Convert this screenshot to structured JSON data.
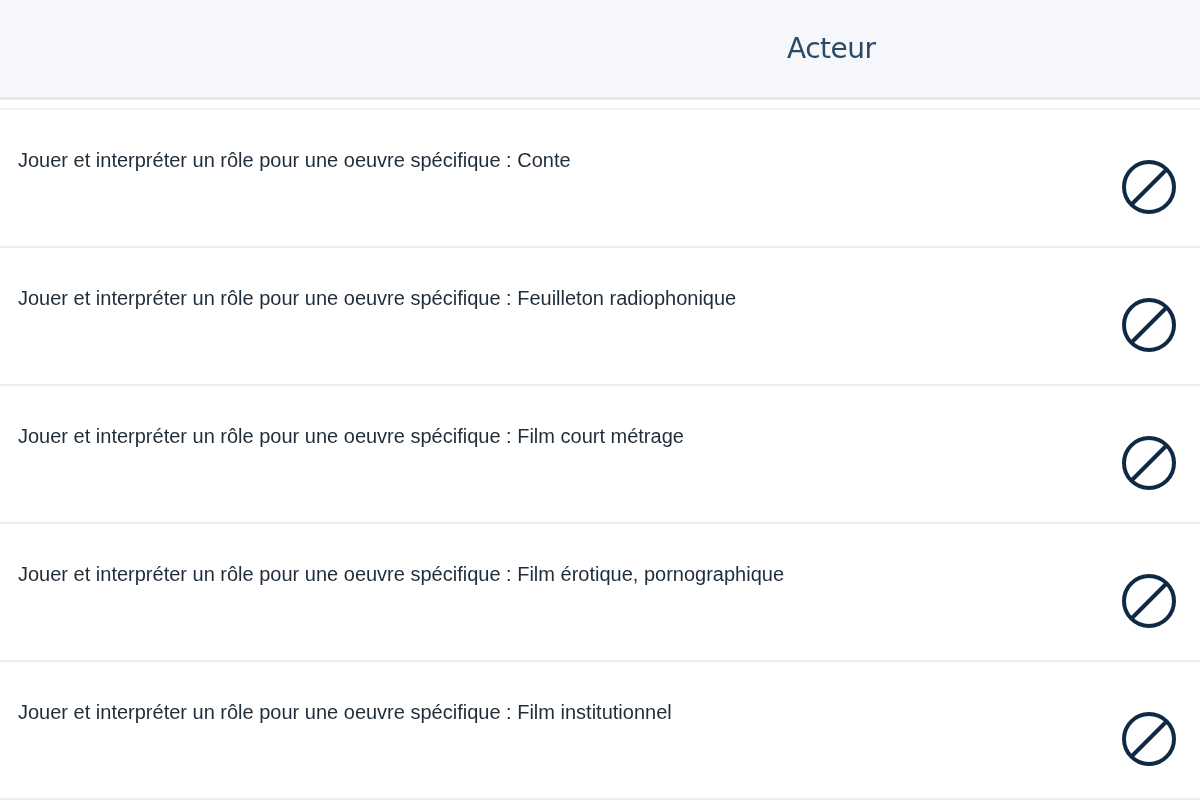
{
  "header": {
    "title": "Acteur"
  },
  "rows": [
    {
      "label": "Jouer et interpréter un rôle pour une oeuvre spécifique : Conte"
    },
    {
      "label": "Jouer et interpréter un rôle pour une oeuvre spécifique : Feuilleton radiophonique"
    },
    {
      "label": "Jouer et interpréter un rôle pour une oeuvre spécifique : Film court métrage"
    },
    {
      "label": "Jouer et interpréter un rôle pour une oeuvre spécifique : Film érotique, pornographique"
    },
    {
      "label": "Jouer et interpréter un rôle pour une oeuvre spécifique : Film institutionnel"
    }
  ]
}
